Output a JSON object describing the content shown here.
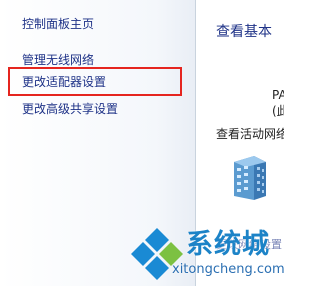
{
  "sidebar": {
    "items": [
      {
        "label": "控制面板主页"
      },
      {
        "label": "管理无线网络"
      },
      {
        "label": "更改适配器设置"
      },
      {
        "label": "更改高级共享设置"
      }
    ]
  },
  "main": {
    "title": "查看基本",
    "partial_1": "PA",
    "partial_2": "(此",
    "active_networks_label": "查看活动网络",
    "partial_bottom": "更改网络设置"
  },
  "watermark": {
    "cn_text": "系统城",
    "en_text": "xitongcheng.com"
  },
  "colors": {
    "link": "#1e3287",
    "highlight_border": "#e5251f",
    "watermark_blue": "#1c83c7"
  }
}
